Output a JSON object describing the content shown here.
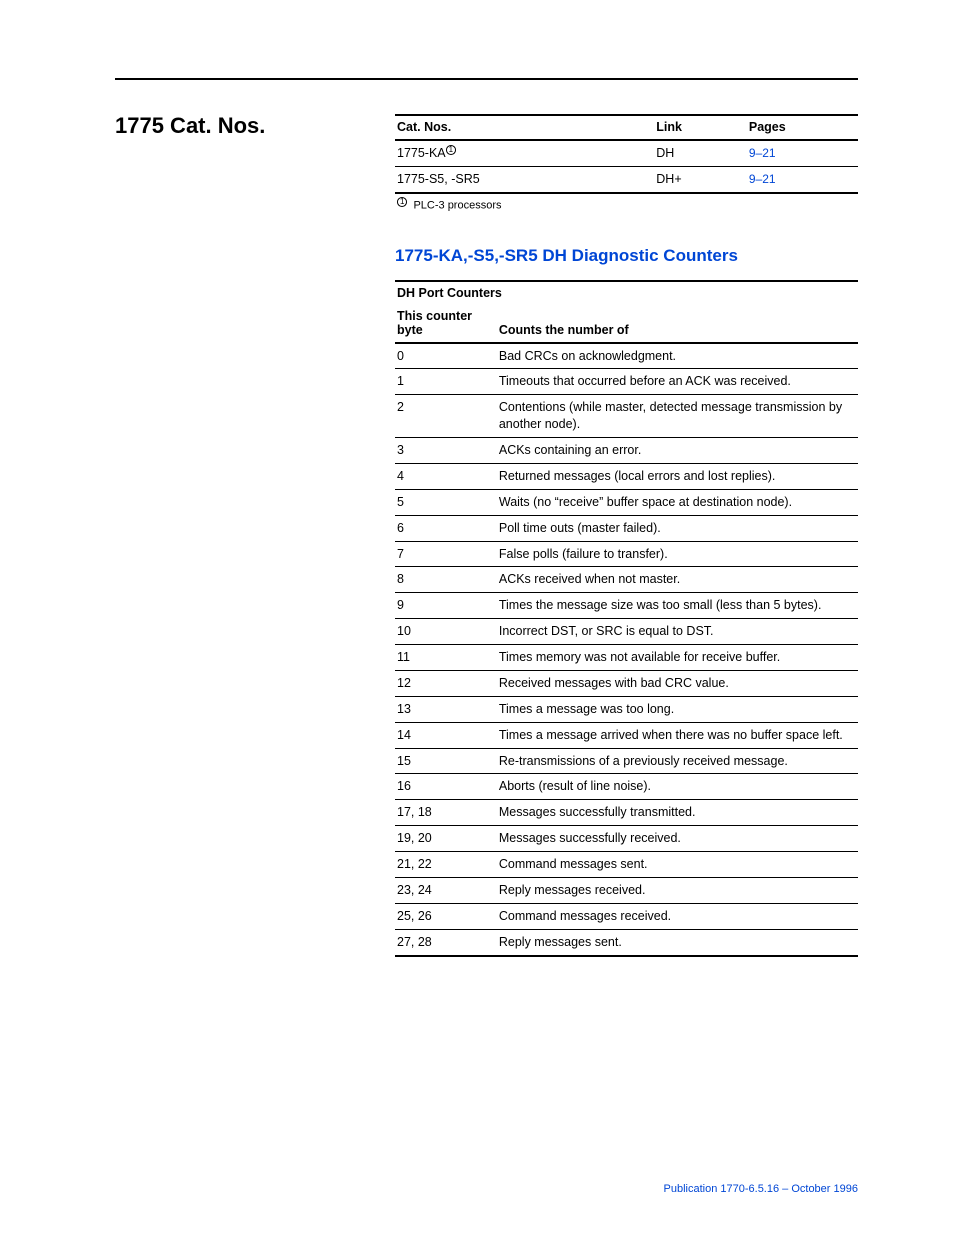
{
  "section_title": "1775 Cat. Nos.",
  "cat_table": {
    "headers": {
      "c1": "Cat. Nos.",
      "c2": "Link",
      "c3": "Pages"
    },
    "rows": [
      {
        "name_prefix": "1775-KA",
        "sup": "1",
        "link": "DH",
        "pages": "9–21"
      },
      {
        "name_prefix": "1775-S5, -SR5",
        "sup": "",
        "link": "DH+",
        "pages": "9–21"
      }
    ],
    "footnote_sup": "1",
    "footnote_text": "PLC-3 processors"
  },
  "sub_heading": "1775-KA,-S5,-SR5 DH Diagnostic Counters",
  "dh_table": {
    "header_group": "DH Port Counters",
    "headers": {
      "c1": "This counter byte",
      "c2": "Counts the number of"
    },
    "rows": [
      {
        "b": "0",
        "d": "Bad CRCs on acknowledgment."
      },
      {
        "b": "1",
        "d": "Timeouts that occurred before an ACK was received."
      },
      {
        "b": "2",
        "d": "Contentions (while master, detected message transmission by another node)."
      },
      {
        "b": "3",
        "d": "ACKs containing an error."
      },
      {
        "b": "4",
        "d": "Returned messages (local errors and lost replies)."
      },
      {
        "b": "5",
        "d": "Waits (no “receive” buffer space at destination node)."
      },
      {
        "b": "6",
        "d": "Poll time outs (master failed)."
      },
      {
        "b": "7",
        "d": "False polls (failure to transfer)."
      },
      {
        "b": "8",
        "d": "ACKs received when not master."
      },
      {
        "b": "9",
        "d": "Times the message size was too small (less than 5 bytes)."
      },
      {
        "b": "10",
        "d": "Incorrect DST, or SRC is equal to DST."
      },
      {
        "b": "11",
        "d": "Times memory was not available for receive buffer."
      },
      {
        "b": "12",
        "d": "Received messages with bad CRC value."
      },
      {
        "b": "13",
        "d": "Times a message was too long."
      },
      {
        "b": "14",
        "d": "Times a message arrived when there was no buffer space left."
      },
      {
        "b": "15",
        "d": "Re-transmissions of a previously received message."
      },
      {
        "b": "16",
        "d": "Aborts (result of line noise)."
      },
      {
        "b": "17, 18",
        "d": "Messages successfully transmitted."
      },
      {
        "b": "19, 20",
        "d": "Messages successfully received."
      },
      {
        "b": "21, 22",
        "d": "Command messages sent."
      },
      {
        "b": "23, 24",
        "d": "Reply messages received."
      },
      {
        "b": "25, 26",
        "d": "Command messages received."
      },
      {
        "b": "27, 28",
        "d": "Reply messages sent."
      }
    ]
  },
  "publication_footer": "Publication 1770-6.5.16 – October 1996"
}
